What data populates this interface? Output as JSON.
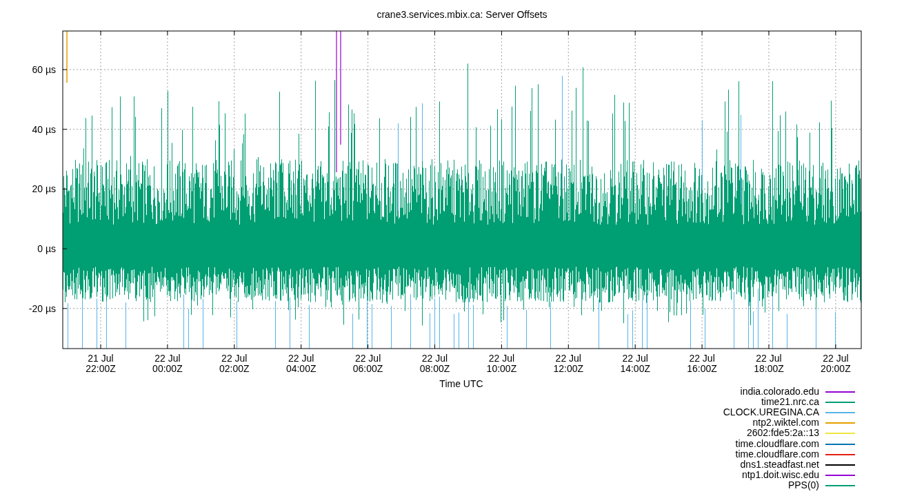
{
  "title": "crane3.services.mbix.ca: Server Offsets",
  "y_ticks": [
    "60 µs",
    "40 µs",
    "20 µs",
    "0 µs",
    "-20 µs"
  ],
  "x_ticks": [
    {
      "date": "21 Jul",
      "time": "22:00Z"
    },
    {
      "date": "22 Jul",
      "time": "00:00Z"
    },
    {
      "date": "22 Jul",
      "time": "02:00Z"
    },
    {
      "date": "22 Jul",
      "time": "04:00Z"
    },
    {
      "date": "22 Jul",
      "time": "06:00Z"
    },
    {
      "date": "22 Jul",
      "time": "08:00Z"
    },
    {
      "date": "22 Jul",
      "time": "10:00Z"
    },
    {
      "date": "22 Jul",
      "time": "12:00Z"
    },
    {
      "date": "22 Jul",
      "time": "14:00Z"
    },
    {
      "date": "22 Jul",
      "time": "16:00Z"
    },
    {
      "date": "22 Jul",
      "time": "18:00Z"
    },
    {
      "date": "22 Jul",
      "time": "20:00Z"
    }
  ],
  "xlabel": "Time UTC",
  "legend": [
    {
      "name": "india.colorado.edu",
      "color": "#9400d3"
    },
    {
      "name": "time21.nrc.ca",
      "color": "#009e73"
    },
    {
      "name": "CLOCK.UREGINA.CA",
      "color": "#56b4e9"
    },
    {
      "name": "ntp2.wiktel.com",
      "color": "#e69f00"
    },
    {
      "name": "2602:fde5:2a::13",
      "color": "#f0e442"
    },
    {
      "name": "time.cloudflare.com",
      "color": "#0072b2"
    },
    {
      "name": "time.cloudflare.com",
      "color": "#e51e10"
    },
    {
      "name": "dns1.steadfast.net",
      "color": "#000000"
    },
    {
      "name": "ntp1.doit.wisc.edu",
      "color": "#9400d3"
    },
    {
      "name": "PPS(0)",
      "color": "#009e73"
    }
  ]
}
